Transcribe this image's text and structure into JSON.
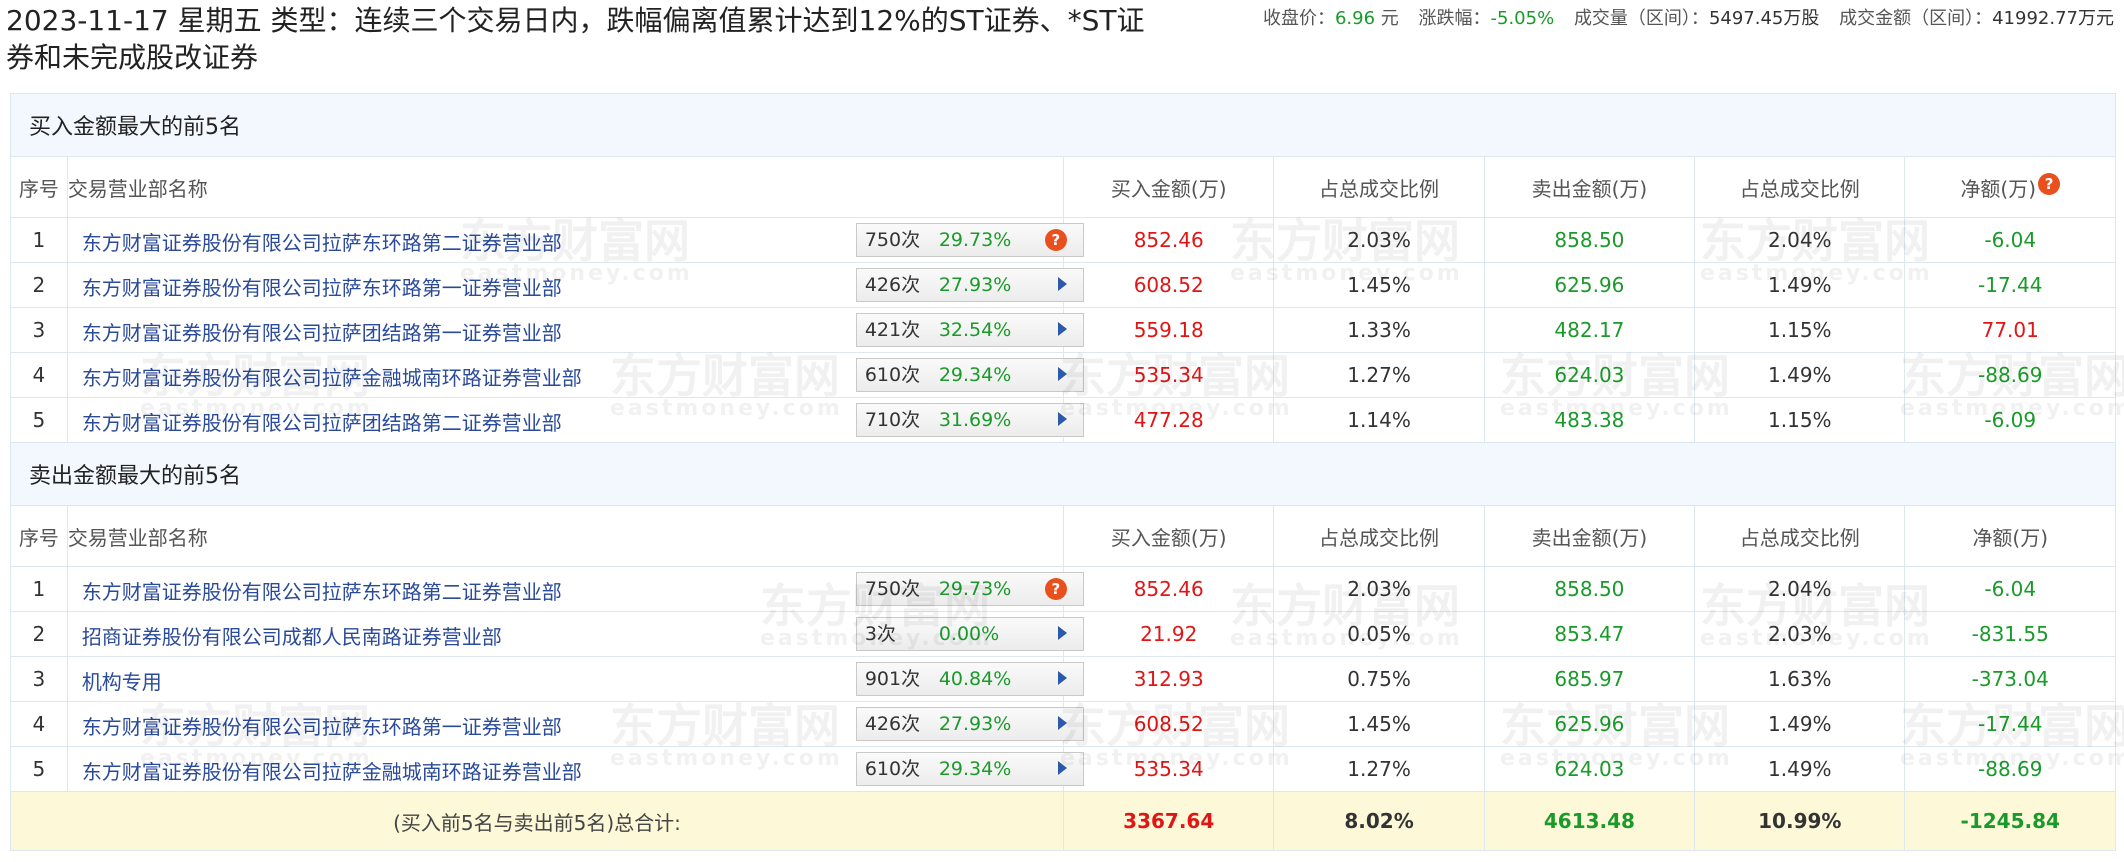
{
  "header": {
    "title": "2023-11-17 星期五 类型：连续三个交易日内，跌幅偏离值累计达到12%的ST证券、*ST证券和未完成股改证券",
    "close_label": "收盘价：",
    "close_value": "6.96",
    "close_unit": "元",
    "change_label": "涨跌幅：",
    "change_value": "-5.05%",
    "volume_label": "成交量（区间）：",
    "volume_value": "5497.45万股",
    "amount_label": "成交金额（区间）：",
    "amount_value": "41992.77万元"
  },
  "columns": {
    "index": "序号",
    "name": "交易营业部名称",
    "buy": "买入金额(万)",
    "buy_ratio": "占总成交比例",
    "sell": "卖出金额(万)",
    "sell_ratio": "占总成交比例",
    "net": "净额(万)"
  },
  "buy_section": {
    "title": "买入金额最大的前5名",
    "rows": [
      {
        "no": "1",
        "name": "东方财富证券股份有限公司拉萨东环路第二证券营业部",
        "count": "750次",
        "rate": "29.73%",
        "icon": "question-icon",
        "buy": "852.46",
        "buy_ratio": "2.03%",
        "sell": "858.50",
        "sell_ratio": "2.04%",
        "net": "-6.04",
        "net_color": "green"
      },
      {
        "no": "2",
        "name": "东方财富证券股份有限公司拉萨东环路第一证券营业部",
        "count": "426次",
        "rate": "27.93%",
        "icon": "arrow-right-icon",
        "buy": "608.52",
        "buy_ratio": "1.45%",
        "sell": "625.96",
        "sell_ratio": "1.49%",
        "net": "-17.44",
        "net_color": "green"
      },
      {
        "no": "3",
        "name": "东方财富证券股份有限公司拉萨团结路第一证券营业部",
        "count": "421次",
        "rate": "32.54%",
        "icon": "arrow-right-icon",
        "buy": "559.18",
        "buy_ratio": "1.33%",
        "sell": "482.17",
        "sell_ratio": "1.15%",
        "net": "77.01",
        "net_color": "red"
      },
      {
        "no": "4",
        "name": "东方财富证券股份有限公司拉萨金融城南环路证券营业部",
        "count": "610次",
        "rate": "29.34%",
        "icon": "arrow-right-icon",
        "buy": "535.34",
        "buy_ratio": "1.27%",
        "sell": "624.03",
        "sell_ratio": "1.49%",
        "net": "-88.69",
        "net_color": "green"
      },
      {
        "no": "5",
        "name": "东方财富证券股份有限公司拉萨团结路第二证券营业部",
        "count": "710次",
        "rate": "31.69%",
        "icon": "arrow-right-icon",
        "buy": "477.28",
        "buy_ratio": "1.14%",
        "sell": "483.38",
        "sell_ratio": "1.15%",
        "net": "-6.09",
        "net_color": "green"
      }
    ]
  },
  "sell_section": {
    "title": "卖出金额最大的前5名",
    "rows": [
      {
        "no": "1",
        "name": "东方财富证券股份有限公司拉萨东环路第二证券营业部",
        "count": "750次",
        "rate": "29.73%",
        "icon": "question-icon",
        "buy": "852.46",
        "buy_ratio": "2.03%",
        "sell": "858.50",
        "sell_ratio": "2.04%",
        "net": "-6.04",
        "net_color": "green"
      },
      {
        "no": "2",
        "name": "招商证券股份有限公司成都人民南路证券营业部",
        "count": "3次",
        "rate": "0.00%",
        "icon": "arrow-right-icon",
        "buy": "21.92",
        "buy_ratio": "0.05%",
        "sell": "853.47",
        "sell_ratio": "2.03%",
        "net": "-831.55",
        "net_color": "green"
      },
      {
        "no": "3",
        "name": "机构专用",
        "count": "901次",
        "rate": "40.84%",
        "icon": "arrow-right-icon",
        "buy": "312.93",
        "buy_ratio": "0.75%",
        "sell": "685.97",
        "sell_ratio": "1.63%",
        "net": "-373.04",
        "net_color": "green"
      },
      {
        "no": "4",
        "name": "东方财富证券股份有限公司拉萨东环路第一证券营业部",
        "count": "426次",
        "rate": "27.93%",
        "icon": "arrow-right-icon",
        "buy": "608.52",
        "buy_ratio": "1.45%",
        "sell": "625.96",
        "sell_ratio": "1.49%",
        "net": "-17.44",
        "net_color": "green"
      },
      {
        "no": "5",
        "name": "东方财富证券股份有限公司拉萨金融城南环路证券营业部",
        "count": "610次",
        "rate": "29.34%",
        "icon": "arrow-right-icon",
        "buy": "535.34",
        "buy_ratio": "1.27%",
        "sell": "624.03",
        "sell_ratio": "1.49%",
        "net": "-88.69",
        "net_color": "green"
      }
    ]
  },
  "total": {
    "label": "(买入前5名与卖出前5名)总合计:",
    "buy": "3367.64",
    "buy_ratio": "8.02%",
    "sell": "4613.48",
    "sell_ratio": "10.99%",
    "net": "-1245.84"
  },
  "colors": {
    "red": "#e01515",
    "green": "#1a9a2a",
    "link": "#2a4a9a",
    "section_bg": "#f2f8fd",
    "total_bg": "#fdf8d8",
    "question_badge": "#e9501e"
  },
  "watermark": {
    "brand": "东方财富网",
    "domain": "eastmoney.com"
  }
}
